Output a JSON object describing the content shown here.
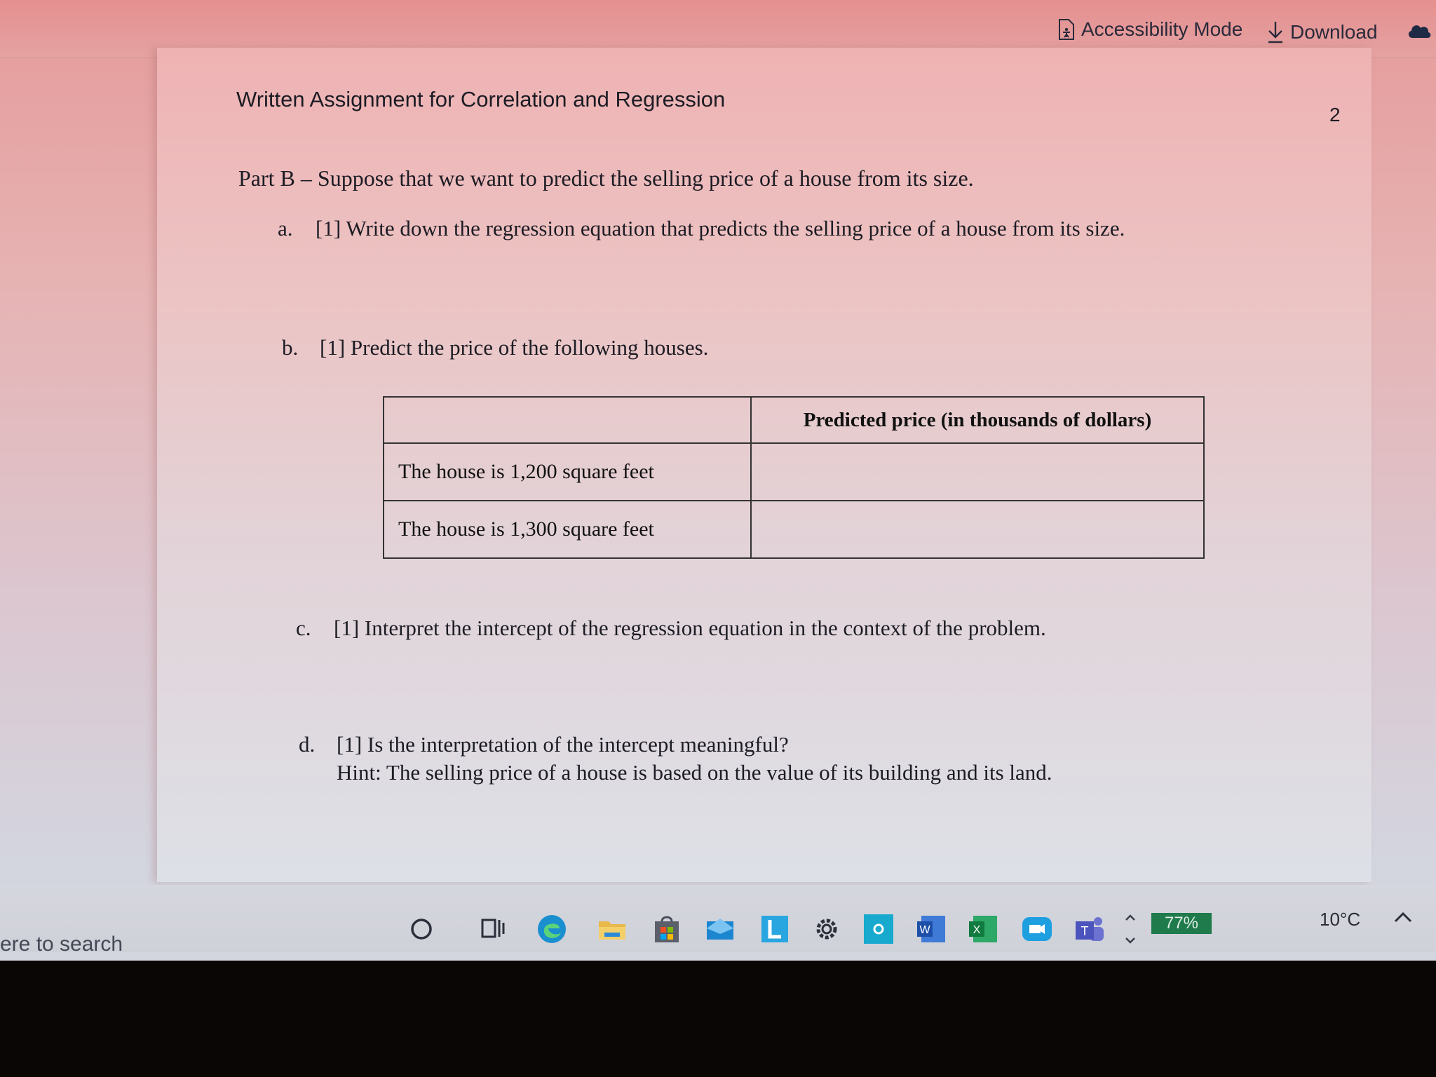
{
  "toolbar": {
    "accessibility_label": "Accessibility Mode",
    "download_label": "Download"
  },
  "document": {
    "title": "Written Assignment for Correlation and Regression",
    "page_number": "2",
    "part_b": "Part B – Suppose that we want to predict the selling price of a house from its size.",
    "questions": {
      "a": {
        "label": "a.",
        "text": "[1] Write down the regression equation that predicts the selling price of a house from its size."
      },
      "b": {
        "label": "b.",
        "text": "[1] Predict the price of the following houses."
      },
      "c": {
        "label": "c.",
        "text": "[1] Interpret the intercept of the regression equation in the context of the problem."
      },
      "d": {
        "label": "d.",
        "text": "[1] Is the interpretation of the intercept meaningful?",
        "hint": "Hint: The selling price of a house is based on the value of its building and its land."
      }
    },
    "table": {
      "header": [
        "",
        "Predicted price (in thousands of dollars)"
      ],
      "rows": [
        [
          "The house is 1,200 square feet",
          ""
        ],
        [
          "The house is 1,300 square feet",
          ""
        ]
      ]
    }
  },
  "taskbar": {
    "search_text": "ere to search",
    "battery": "77%",
    "temperature": "10°C"
  }
}
